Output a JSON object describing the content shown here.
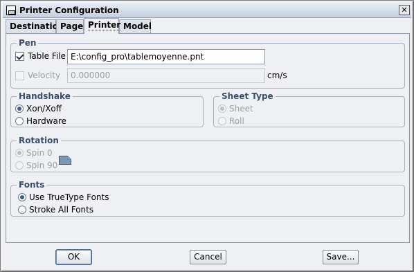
{
  "window": {
    "title": "Printer Configuration"
  },
  "tabs": [
    {
      "label": "Destination"
    },
    {
      "label": "Page"
    },
    {
      "label": "Printer"
    },
    {
      "label": "Model"
    }
  ],
  "pen": {
    "legend": "Pen",
    "table_file": {
      "label": "Table File",
      "checked": true,
      "value": "E:\\config_pro\\tablemoyenne.pnt"
    },
    "velocity": {
      "label": "Velocity",
      "checked": false,
      "enabled": false,
      "value": "0.000000",
      "unit": "cm/s"
    }
  },
  "handshake": {
    "legend": "Handshake",
    "options": [
      {
        "label": "Xon/Xoff",
        "selected": true
      },
      {
        "label": "Hardware",
        "selected": false
      }
    ]
  },
  "sheet_type": {
    "legend": "Sheet Type",
    "options": [
      {
        "label": "Sheet",
        "selected": true
      },
      {
        "label": "Roll",
        "selected": false
      }
    ]
  },
  "rotation": {
    "legend": "Rotation",
    "options": [
      {
        "label": "Spin 0",
        "selected": true
      },
      {
        "label": "Spin 90",
        "selected": false
      }
    ]
  },
  "fonts": {
    "legend": "Fonts",
    "options": [
      {
        "label": "Use TrueType Fonts",
        "selected": true
      },
      {
        "label": "Stroke All Fonts",
        "selected": false
      }
    ]
  },
  "buttons": {
    "ok": "OK",
    "cancel": "Cancel",
    "save": "Save..."
  }
}
